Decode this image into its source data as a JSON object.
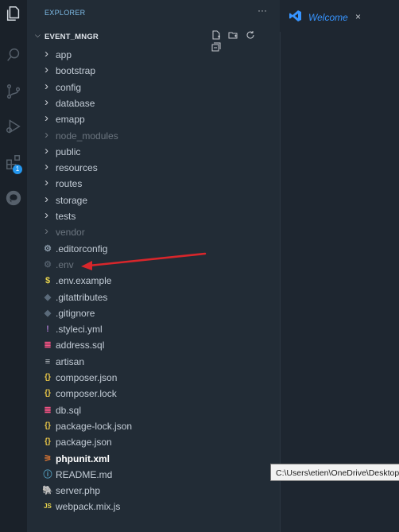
{
  "sidebar": {
    "title": "EXPLORER",
    "more_label": "···",
    "project_name": "EVENT_MNGR"
  },
  "tab": {
    "label": "Welcome",
    "close_label": "×"
  },
  "activity": {
    "badge_count": "1"
  },
  "tree": [
    {
      "label": "app",
      "kind": "folder"
    },
    {
      "label": "bootstrap",
      "kind": "folder"
    },
    {
      "label": "config",
      "kind": "folder"
    },
    {
      "label": "database",
      "kind": "folder"
    },
    {
      "label": "emapp",
      "kind": "folder"
    },
    {
      "label": "node_modules",
      "kind": "folder",
      "dim": true
    },
    {
      "label": "public",
      "kind": "folder"
    },
    {
      "label": "resources",
      "kind": "folder"
    },
    {
      "label": "routes",
      "kind": "folder"
    },
    {
      "label": "storage",
      "kind": "folder"
    },
    {
      "label": "tests",
      "kind": "folder"
    },
    {
      "label": "vendor",
      "kind": "folder",
      "dim": true
    },
    {
      "label": ".editorconfig",
      "icon": "gear-icon",
      "glyph": "⚙",
      "color": "#8a9aa9"
    },
    {
      "label": ".env",
      "icon": "gear-icon",
      "glyph": "⚙",
      "color": "#8a9aa9",
      "dim": true
    },
    {
      "label": ".env.example",
      "icon": "dollar-icon",
      "glyph": "$",
      "color": "#e8d44d"
    },
    {
      "label": ".gitattributes",
      "icon": "git-diamond-icon",
      "glyph": "◆",
      "color": "#5a6a7a"
    },
    {
      "label": ".gitignore",
      "icon": "git-diamond-icon",
      "glyph": "◆",
      "color": "#5a6a7a"
    },
    {
      "label": ".styleci.yml",
      "icon": "exclamation-icon",
      "glyph": "!",
      "color": "#a074c4"
    },
    {
      "label": "address.sql",
      "icon": "database-icon",
      "glyph": "≣",
      "color": "#f55385"
    },
    {
      "label": "artisan",
      "icon": "lines-icon",
      "glyph": "≡",
      "color": "#c5c9cf"
    },
    {
      "label": "composer.json",
      "icon": "braces-icon",
      "glyph": "{}",
      "color": "#e8c547"
    },
    {
      "label": "composer.lock",
      "icon": "braces-icon",
      "glyph": "{}",
      "color": "#e8c547"
    },
    {
      "label": "db.sql",
      "icon": "database-icon",
      "glyph": "≣",
      "color": "#f55385"
    },
    {
      "label": "package-lock.json",
      "icon": "braces-icon",
      "glyph": "{}",
      "color": "#e8c547"
    },
    {
      "label": "package.json",
      "icon": "braces-icon",
      "glyph": "{}",
      "color": "#e8c547"
    },
    {
      "label": "phpunit.xml",
      "icon": "rss-icon",
      "glyph": "⚞",
      "color": "#e37933",
      "bright": true
    },
    {
      "label": "README.md",
      "icon": "info-icon",
      "glyph": "ⓘ",
      "color": "#519aba"
    },
    {
      "label": "server.php",
      "icon": "elephant-icon",
      "glyph": "🐘",
      "color": "#a074c4"
    },
    {
      "label": "webpack.mix.js",
      "icon": "js-icon",
      "glyph": "JS",
      "color": "#e8d44d"
    }
  ],
  "tooltip": {
    "text": "C:\\Users\\etien\\OneDrive\\Desktop"
  },
  "colors": {
    "accent": "#3794ff",
    "arrow": "#d8262b"
  }
}
